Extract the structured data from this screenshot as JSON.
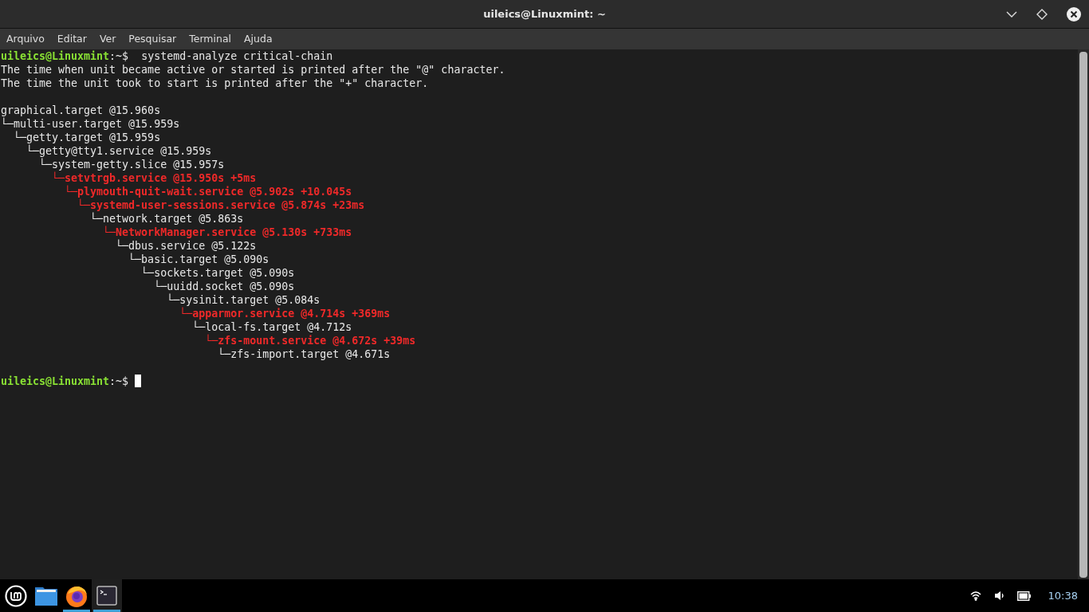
{
  "window": {
    "title": "uileics@Linuxmint: ~"
  },
  "menu": [
    {
      "label": "Arquivo"
    },
    {
      "label": "Editar"
    },
    {
      "label": "Ver"
    },
    {
      "label": "Pesquisar"
    },
    {
      "label": "Terminal"
    },
    {
      "label": "Ajuda"
    }
  ],
  "terminal": {
    "lines": [
      {
        "kind": "prompt",
        "user_host": "uileics@Linuxmint",
        "prompt_tail": ":~$",
        "command": "systemd-analyze critical-chain",
        "cursor": false
      },
      {
        "kind": "output",
        "text": "The time when unit became active or started is printed after the \"@\" character.",
        "highlight": false
      },
      {
        "kind": "output",
        "text": "The time the unit took to start is printed after the \"+\" character.",
        "highlight": false
      },
      {
        "kind": "blank"
      },
      {
        "kind": "output",
        "text": "graphical.target @15.960s",
        "highlight": false
      },
      {
        "kind": "output",
        "text": "└─multi-user.target @15.959s",
        "highlight": false
      },
      {
        "kind": "output",
        "text": "  └─getty.target @15.959s",
        "highlight": false
      },
      {
        "kind": "output",
        "text": "    └─getty@tty1.service @15.959s",
        "highlight": false
      },
      {
        "kind": "output",
        "text": "      └─system-getty.slice @15.957s",
        "highlight": false
      },
      {
        "kind": "output",
        "text": "        └─setvtrgb.service @15.950s +5ms",
        "highlight": true
      },
      {
        "kind": "output",
        "text": "          └─plymouth-quit-wait.service @5.902s +10.045s",
        "highlight": true
      },
      {
        "kind": "output",
        "text": "            └─systemd-user-sessions.service @5.874s +23ms",
        "highlight": true
      },
      {
        "kind": "output",
        "text": "              └─network.target @5.863s",
        "highlight": false
      },
      {
        "kind": "output",
        "text": "                └─NetworkManager.service @5.130s +733ms",
        "highlight": true
      },
      {
        "kind": "output",
        "text": "                  └─dbus.service @5.122s",
        "highlight": false
      },
      {
        "kind": "output",
        "text": "                    └─basic.target @5.090s",
        "highlight": false
      },
      {
        "kind": "output",
        "text": "                      └─sockets.target @5.090s",
        "highlight": false
      },
      {
        "kind": "output",
        "text": "                        └─uuidd.socket @5.090s",
        "highlight": false
      },
      {
        "kind": "output",
        "text": "                          └─sysinit.target @5.084s",
        "highlight": false
      },
      {
        "kind": "output",
        "text": "                            └─apparmor.service @4.714s +369ms",
        "highlight": true
      },
      {
        "kind": "output",
        "text": "                              └─local-fs.target @4.712s",
        "highlight": false
      },
      {
        "kind": "output",
        "text": "                                └─zfs-mount.service @4.672s +39ms",
        "highlight": true
      },
      {
        "kind": "output",
        "text": "                                  └─zfs-import.target @4.671s",
        "highlight": false
      },
      {
        "kind": "blank"
      },
      {
        "kind": "prompt",
        "user_host": "uileics@Linuxmint",
        "prompt_tail": ":~$",
        "cursor": true
      }
    ]
  },
  "taskbar": {
    "apps": [
      {
        "kind": "menu",
        "running": false,
        "selected": false
      },
      {
        "kind": "files",
        "running": false,
        "selected": false
      },
      {
        "kind": "browser",
        "running": true,
        "selected": false
      },
      {
        "kind": "terminal",
        "running": true,
        "selected": true
      }
    ],
    "clock": "10:38"
  }
}
